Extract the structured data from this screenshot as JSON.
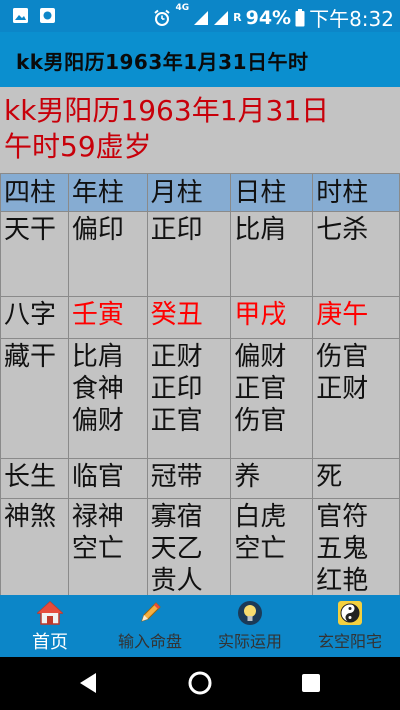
{
  "status_bar": {
    "net_label": "4G",
    "roaming": "R",
    "battery": "94%",
    "time": "下午8:32"
  },
  "app_bar": {
    "title": "kk男阳历1963年1月31日午时"
  },
  "headline": {
    "line1": "kk男阳历1963年1月31日",
    "line2": "午时59虚岁"
  },
  "table": {
    "headers": [
      "四柱",
      "年柱",
      "月柱",
      "日柱",
      "时柱"
    ],
    "tiangan": {
      "label": "天干",
      "cells": [
        "偏印",
        "正印",
        "比肩",
        "七杀"
      ]
    },
    "bazi": {
      "label": "八字",
      "cells": [
        "壬寅",
        "癸丑",
        "甲戌",
        "庚午"
      ]
    },
    "canggan": {
      "label": "藏干",
      "cells": [
        [
          "比肩",
          "食神",
          "偏财"
        ],
        [
          "正财",
          "正印",
          "正官"
        ],
        [
          "偏财",
          "正官",
          "伤官"
        ],
        [
          "伤官",
          "正财"
        ]
      ]
    },
    "changsheng": {
      "label": "长生",
      "cells": [
        "临官",
        "冠带",
        "养",
        "死"
      ]
    },
    "shensha": {
      "label": "神煞",
      "cells": [
        [
          "禄神",
          "空亡"
        ],
        [
          "寡宿",
          "天乙",
          "贵人"
        ],
        [
          "白虎",
          "空亡"
        ],
        [
          "官符",
          "五鬼",
          "红艳"
        ]
      ]
    }
  },
  "bottom_nav": [
    {
      "label": "首页",
      "icon": "home-icon"
    },
    {
      "label": "输入命盘",
      "icon": "pencil-icon"
    },
    {
      "label": "实际运用",
      "icon": "lightbulb-icon"
    },
    {
      "label": "玄空阳宅",
      "icon": "yin-yang-icon"
    }
  ],
  "colors": {
    "status_bar": "#0c86c8",
    "app_bar": "#0b8fcf",
    "headline": "#c8000a",
    "bazi": "#ff0000",
    "table_header": "#86acd2",
    "content_bg": "#c3c3c3"
  }
}
